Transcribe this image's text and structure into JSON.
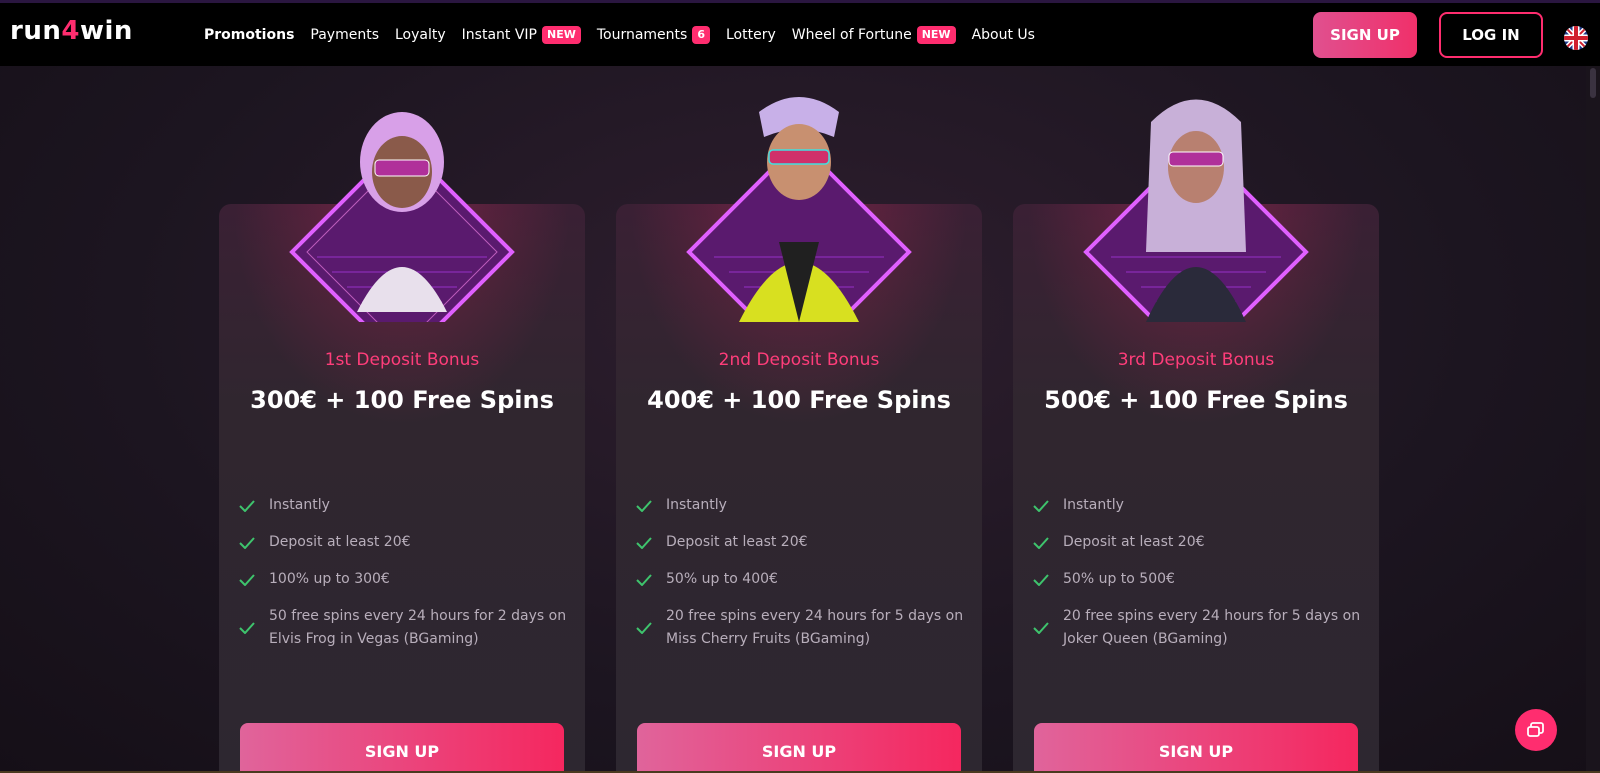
{
  "brand": {
    "logo_prefix": "run",
    "logo_digit": "4",
    "logo_suffix": "win"
  },
  "nav": [
    {
      "label": "Promotions",
      "active": true
    },
    {
      "label": "Payments"
    },
    {
      "label": "Loyalty"
    },
    {
      "label": "Instant VIP",
      "badge": "NEW"
    },
    {
      "label": "Tournaments",
      "badge": "6"
    },
    {
      "label": "Lottery"
    },
    {
      "label": "Wheel of Fortune",
      "badge": "NEW"
    },
    {
      "label": "About Us"
    }
  ],
  "header": {
    "signup_label": "SIGN UP",
    "login_label": "LOG IN",
    "language_icon": "uk-flag-icon"
  },
  "cards": [
    {
      "subtitle": "1st Deposit Bonus",
      "title": "300€ + 100 Free Spins",
      "features": [
        "Instantly",
        "Deposit at least 20€",
        "100% up to 300€",
        "50 free spins every 24 hours for 2 days on Elvis Frog in Vegas (BGaming)"
      ],
      "button": "SIGN UP"
    },
    {
      "subtitle": "2nd Deposit Bonus",
      "title": "400€ + 100 Free Spins",
      "features": [
        "Instantly",
        "Deposit at least 20€",
        "50% up to 400€",
        "20 free spins every 24 hours for 5 days on Miss Cherry Fruits (BGaming)"
      ],
      "button": "SIGN UP"
    },
    {
      "subtitle": "3rd Deposit Bonus",
      "title": "500€ + 100 Free Spins",
      "features": [
        "Instantly",
        "Deposit at least 20€",
        "50% up to 500€",
        "20 free spins every 24 hours for 5 days on Joker Queen (BGaming)"
      ],
      "button": "SIGN UP"
    }
  ],
  "colors": {
    "accent": "#ff2d6f",
    "check": "#3ec46d",
    "feature_text": "#b8aebb"
  }
}
